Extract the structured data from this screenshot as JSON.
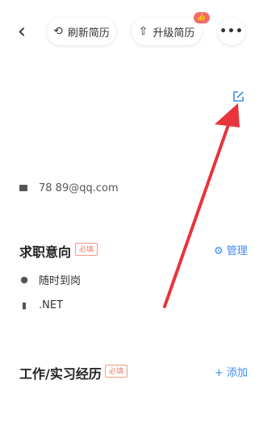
{
  "top_bar": {
    "back_glyph": "‹",
    "refresh": {
      "label": "刷新简历",
      "icon": "refresh-icon"
    },
    "upgrade": {
      "label": "升级简历",
      "icon": "arrow-up-icon"
    },
    "badge_icon": "thumb-up-icon",
    "more_glyph": "•••"
  },
  "contact": {
    "email_text": "78      89@qq.com",
    "icon": "mail-icon"
  },
  "job_intent": {
    "title": "求职意向",
    "required_tag": "必填",
    "manage": {
      "label": "管理",
      "icon": "gear-icon"
    },
    "availability": {
      "label": "随时到岗",
      "icon": "clock-icon"
    },
    "position": {
      "label": ".NET",
      "icon": "document-icon"
    }
  },
  "work_experience": {
    "title": "工作/实习经历",
    "required_tag": "必填",
    "add_label": "+ 添加"
  },
  "colors": {
    "accent_blue": "#3d8bf2",
    "required_orange": "#ef7a63",
    "annotation_red": "#e8343b"
  }
}
